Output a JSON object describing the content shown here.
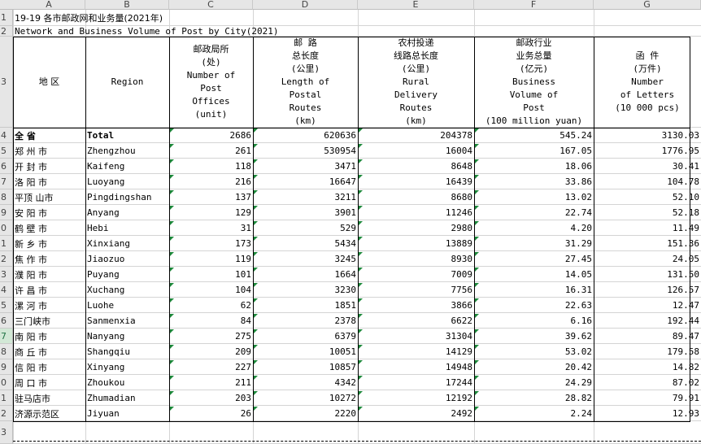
{
  "columns": [
    "A",
    "B",
    "C",
    "D",
    "E",
    "F",
    "G"
  ],
  "row_numbers": [
    "1",
    "2",
    "3",
    "4",
    "5",
    "6",
    "7",
    "8",
    "9",
    "0",
    "1",
    "2",
    "3",
    "4",
    "5",
    "6",
    "7",
    "8",
    "9",
    "0",
    "1",
    "2",
    "3"
  ],
  "title_cn": "19-19 各市邮政网和业务量(2021年)",
  "title_en": "Network and Business Volume of Post by City(2021)",
  "headers": {
    "region_cn": "地 区",
    "region_en": "Region",
    "c": "邮政局所\n(处)\nNumber of\nPost\nOffices\n(unit)",
    "d": "邮 路\n总长度\n(公里)\nLength of\nPostal\nRoutes\n(km)",
    "e": "农村投递\n线路总长度\n(公里)\nRural\nDelivery\nRoutes\n(km)",
    "f": "邮政行业\n业务总量\n(亿元)\nBusiness\nVolume of\nPost\n(100 million yuan)",
    "g": "函 件\n(万件)\nNumber\nof Letters\n(10 000 pcs)"
  },
  "rows": [
    {
      "cn": "全 省",
      "en": "Total",
      "c": "2686",
      "d": "620636",
      "e": "204378",
      "f": "545.24",
      "g": "3130.03",
      "bold": true
    },
    {
      "cn": "郑 州 市",
      "en": "Zhengzhou",
      "c": "261",
      "d": "530954",
      "e": "16004",
      "f": "167.05",
      "g": "1776.95"
    },
    {
      "cn": "开 封 市",
      "en": "Kaifeng",
      "c": "118",
      "d": "3471",
      "e": "8648",
      "f": "18.06",
      "g": "30.41"
    },
    {
      "cn": "洛 阳 市",
      "en": "Luoyang",
      "c": "216",
      "d": "16647",
      "e": "16439",
      "f": "33.86",
      "g": "104.78"
    },
    {
      "cn": "平顶 山市",
      "en": "Pingdingshan",
      "c": "137",
      "d": "3211",
      "e": "8680",
      "f": "13.02",
      "g": "52.10"
    },
    {
      "cn": "安 阳 市",
      "en": "Anyang",
      "c": "129",
      "d": "3901",
      "e": "11246",
      "f": "22.74",
      "g": "52.18"
    },
    {
      "cn": "鹤 壁 市",
      "en": "Hebi",
      "c": "31",
      "d": "529",
      "e": "2980",
      "f": "4.20",
      "g": "11.49"
    },
    {
      "cn": "新 乡 市",
      "en": "Xinxiang",
      "c": "173",
      "d": "5434",
      "e": "13889",
      "f": "31.29",
      "g": "151.36"
    },
    {
      "cn": "焦 作 市",
      "en": "Jiaozuo",
      "c": "119",
      "d": "3245",
      "e": "8930",
      "f": "27.45",
      "g": "24.05"
    },
    {
      "cn": "濮 阳 市",
      "en": "Puyang",
      "c": "101",
      "d": "1664",
      "e": "7009",
      "f": "14.05",
      "g": "131.50"
    },
    {
      "cn": "许 昌 市",
      "en": "Xuchang",
      "c": "104",
      "d": "3230",
      "e": "7756",
      "f": "16.31",
      "g": "126.57"
    },
    {
      "cn": "漯 河 市",
      "en": "Luohe",
      "c": "62",
      "d": "1851",
      "e": "3866",
      "f": "22.63",
      "g": "12.47"
    },
    {
      "cn": "三门峡市",
      "en": "Sanmenxia",
      "c": "84",
      "d": "2378",
      "e": "6622",
      "f": "6.16",
      "g": "192.44"
    },
    {
      "cn": "南 阳 市",
      "en": "Nanyang",
      "c": "275",
      "d": "6379",
      "e": "31304",
      "f": "39.62",
      "g": "89.47"
    },
    {
      "cn": "商 丘 市",
      "en": "Shangqiu",
      "c": "209",
      "d": "10051",
      "e": "14129",
      "f": "53.02",
      "g": "179.58"
    },
    {
      "cn": "信 阳 市",
      "en": "Xinyang",
      "c": "227",
      "d": "10857",
      "e": "14948",
      "f": "20.42",
      "g": "14.82"
    },
    {
      "cn": "周 口 市",
      "en": "Zhoukou",
      "c": "211",
      "d": "4342",
      "e": "17244",
      "f": "24.29",
      "g": "87.02"
    },
    {
      "cn": "驻马店市",
      "en": "Zhumadian",
      "c": "203",
      "d": "10272",
      "e": "12192",
      "f": "28.82",
      "g": "79.91"
    },
    {
      "cn": "济源示范区",
      "en": "Jiyuan",
      "c": "26",
      "d": "2220",
      "e": "2492",
      "f": "2.24",
      "g": "12.93"
    }
  ],
  "accent_colors": {
    "selected_row_header": "#d2e8d6",
    "number_as_text_flag": "#1e8a3c"
  }
}
